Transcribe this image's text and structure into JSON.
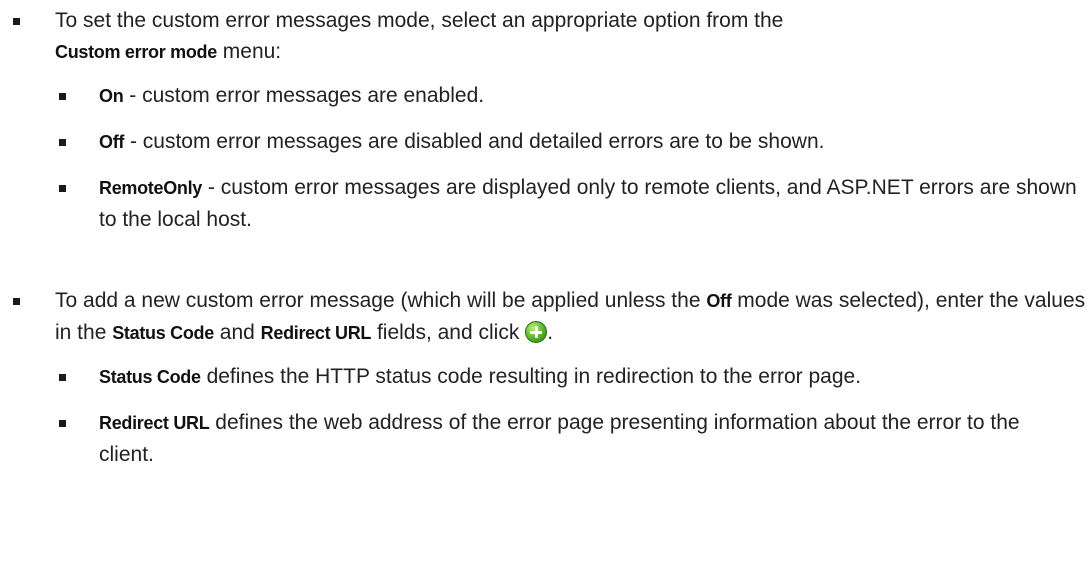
{
  "item1": {
    "intro": "To set the custom error messages mode, select an appropriate option from the",
    "menu_name": "Custom error mode",
    "menu_suffix": "menu:",
    "options": [
      {
        "term": "On",
        "desc": "- custom error messages are enabled."
      },
      {
        "term": "Off",
        "desc": "- custom error messages are disabled and detailed errors are to be shown."
      },
      {
        "term": "RemoteOnly",
        "desc": "- custom error messages are displayed only to remote clients, and ASP.NET errors are shown to the local host."
      }
    ]
  },
  "item2": {
    "text_a": "To add a new custom error message (which will be applied unless the",
    "off_term": "Off",
    "text_b": "mode was selected), enter the values in the",
    "status_term": "Status Code",
    "text_and": "and",
    "redirect_term": "Redirect URL",
    "text_c": "fields, and click",
    "text_end": ".",
    "icon": "add-icon",
    "fields": [
      {
        "term": "Status Code",
        "desc": "defines the HTTP status code resulting in redirection to the error page."
      },
      {
        "term": "Redirect URL",
        "desc": "defines the web address of the error page presenting information about the error to the client."
      }
    ]
  }
}
